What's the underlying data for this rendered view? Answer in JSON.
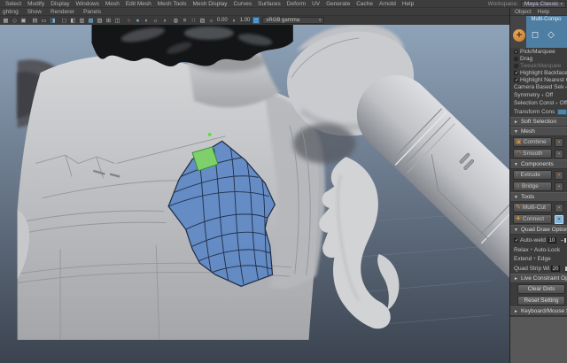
{
  "menu_bar": {
    "items": [
      "Select",
      "Modify",
      "Display",
      "Windows",
      "Mesh",
      "Edit Mesh",
      "Mesh Tools",
      "Mesh Display",
      "Curves",
      "Surfaces",
      "Deform",
      "UV",
      "Generate",
      "Cache",
      "Arnold",
      "Help"
    ],
    "workspace_label": "Workspace:",
    "workspace_value": "Maya Classic"
  },
  "panel_menu": {
    "items": [
      "ghting",
      "Show",
      "Renderer",
      "Panels"
    ]
  },
  "viewport_toolbar": {
    "icons": [
      {
        "name": "snap-grid-icon",
        "glyph": "▦",
        "cls": ""
      },
      {
        "name": "select-camera-icon",
        "glyph": "◇",
        "cls": ""
      },
      {
        "name": "lock-camera-icon",
        "glyph": "▣",
        "cls": "gap"
      },
      {
        "name": "camera-attributes-icon",
        "glyph": "▤",
        "cls": ""
      },
      {
        "name": "bookmarks-icon",
        "glyph": "▭",
        "cls": ""
      },
      {
        "name": "image-plane-icon",
        "glyph": "◨",
        "cls": "gap blue"
      },
      {
        "name": "2d-pan-zoom-icon",
        "glyph": "◻",
        "cls": ""
      },
      {
        "name": "oversc an-icon",
        "glyph": "◧",
        "cls": ""
      },
      {
        "name": "film-gate-icon",
        "glyph": "▥",
        "cls": ""
      },
      {
        "name": "resolution-gate-icon",
        "glyph": "▩",
        "cls": "blue"
      },
      {
        "name": "gate-mask-icon",
        "glyph": "▨",
        "cls": ""
      },
      {
        "name": "field-chart-icon",
        "glyph": "⊞",
        "cls": ""
      },
      {
        "name": "safe-action-icon",
        "glyph": "◫",
        "cls": "gap"
      },
      {
        "name": "wireframe-icon",
        "glyph": "○",
        "cls": ""
      },
      {
        "name": "shaded-icon",
        "glyph": "●",
        "cls": "blue"
      },
      {
        "name": "textured-icon",
        "glyph": "◐",
        "cls": ""
      },
      {
        "name": "lights-icon",
        "glyph": "☼",
        "cls": ""
      },
      {
        "name": "shadows-icon",
        "glyph": "◑",
        "cls": "gap"
      },
      {
        "name": "ao-icon",
        "glyph": "◍",
        "cls": ""
      },
      {
        "name": "motion-blur-icon",
        "glyph": "≡",
        "cls": ""
      },
      {
        "name": "multisample-icon",
        "glyph": "∷",
        "cls": ""
      },
      {
        "name": "xray-icon",
        "glyph": "▧",
        "cls": ""
      }
    ],
    "exposure": "0.00",
    "gamma": "1.00",
    "view_transform": "sRGB gamma"
  },
  "toolkit": {
    "menu": [
      "Object",
      "Help"
    ],
    "title": "Multi-Compo",
    "radios": [
      {
        "label": "Pick/Marquee",
        "state": "selected"
      },
      {
        "label": "Drag",
        "state": "none"
      },
      {
        "label": "Tweak/Marquee",
        "state": "dim"
      }
    ],
    "checks": [
      {
        "label": "Highlight Backfaces",
        "mark": "✓"
      },
      {
        "label": "Highlight Nearest Comp",
        "mark": "✓"
      }
    ],
    "camera_label": "Camera Based Selection",
    "sym_label": "Symmetry",
    "sym_value": "Off",
    "selcon_label": "Selection Constraint",
    "selcon_value": "Off",
    "tcon_label": "Transform Constraint",
    "soft_label": "Soft Selection",
    "mesh_label": "Mesh",
    "mesh_buttons": [
      {
        "label": "Combine",
        "icon": "▣"
      },
      {
        "label": "Smooth",
        "icon": "◠"
      }
    ],
    "comp_label": "Components",
    "comp_buttons": [
      {
        "label": "Extrude",
        "icon": "↑"
      },
      {
        "label": "Bridge",
        "icon": "∩"
      }
    ],
    "tools_label": "Tools",
    "tool_buttons": [
      {
        "label": "Multi-Cut",
        "icon": "✎",
        "opt": ""
      },
      {
        "label": "Connect",
        "icon": "✚",
        "opt": "active"
      }
    ],
    "quad_label": "Quad Draw Options",
    "autoweld_check": "✓",
    "autoweld_label": "Auto-weld",
    "autoweld_value": "10",
    "relax_label": "Relax",
    "relax_value": "Auto-Lock",
    "extend_label": "Extend",
    "extend_value": "Edge",
    "strip_label": "Quad Strip Width:",
    "strip_value": "20",
    "live_label": "Live Constraint Options",
    "clear_btn": "Clear Dots",
    "reset_btn": "Reset Setting",
    "shortcuts_label": "Keyboard/Mouse Short"
  },
  "colors": {
    "accent_blue": "#5285a6",
    "icon_orange": "#d28a3c",
    "patch_blue": "#5e88c6",
    "patch_edge": "#1d2c44",
    "quad_green": "#7fd06a",
    "vertex_green": "#4ee62e"
  }
}
